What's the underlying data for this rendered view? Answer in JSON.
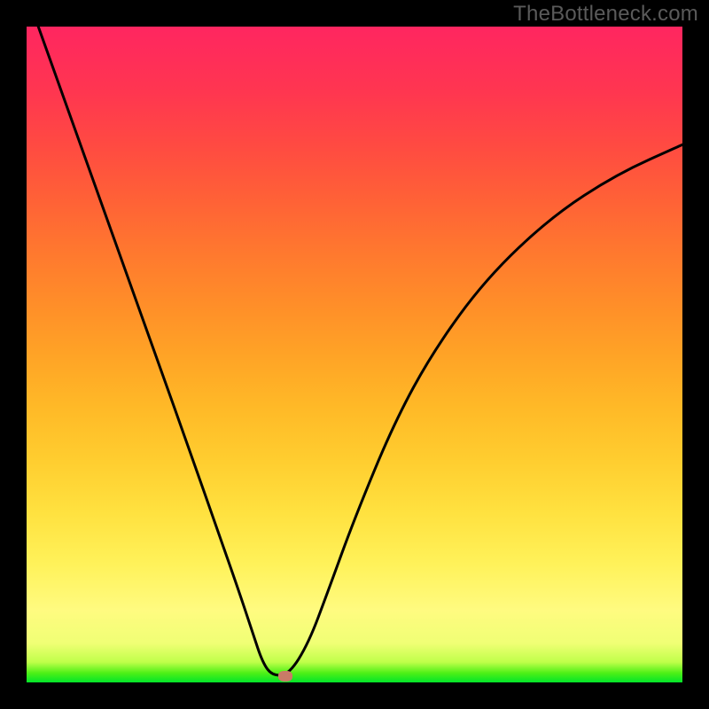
{
  "watermark": "TheBottleneck.com",
  "colors": {
    "frame": "#000000",
    "marker": "#c97b67",
    "curve": "#000000"
  },
  "chart_data": {
    "type": "line",
    "title": "",
    "xlabel": "",
    "ylabel": "",
    "xlim": [
      0,
      1
    ],
    "ylim": [
      0,
      1
    ],
    "legend": null,
    "annotations": [],
    "notes": "The chart has no numeric axis ticks or labels visible; values are estimated as fractional positions (0=left/bottom, 1=right/top). Background is a vertical gradient from green (bottom) through yellow/orange to red (top). A single black curve descends steeply from top-left to a minimum near x≈0.38 and rises less steeply toward the right edge. A small rounded marker sits near the curve minimum.",
    "background_gradient": {
      "stops": [
        {
          "t": 0.0,
          "hex": "#02e52a"
        },
        {
          "t": 0.03,
          "hex": "#c0ff4a"
        },
        {
          "t": 0.11,
          "hex": "#fffb80"
        },
        {
          "t": 0.26,
          "hex": "#ffe13f"
        },
        {
          "t": 0.5,
          "hex": "#ffa326"
        },
        {
          "t": 0.74,
          "hex": "#ff6037"
        },
        {
          "t": 1.0,
          "hex": "#ff2660"
        }
      ]
    },
    "marker": {
      "x": 0.395,
      "y": 0.01
    },
    "series": [
      {
        "name": "curve",
        "x": [
          0.0,
          0.05,
          0.1,
          0.15,
          0.2,
          0.25,
          0.29,
          0.32,
          0.345,
          0.36,
          0.375,
          0.4,
          0.43,
          0.46,
          0.5,
          0.56,
          0.62,
          0.7,
          0.8,
          0.9,
          1.0
        ],
        "y": [
          1.05,
          0.91,
          0.77,
          0.63,
          0.49,
          0.35,
          0.235,
          0.15,
          0.075,
          0.03,
          0.01,
          0.012,
          0.06,
          0.14,
          0.25,
          0.395,
          0.505,
          0.615,
          0.71,
          0.775,
          0.82
        ]
      }
    ]
  }
}
